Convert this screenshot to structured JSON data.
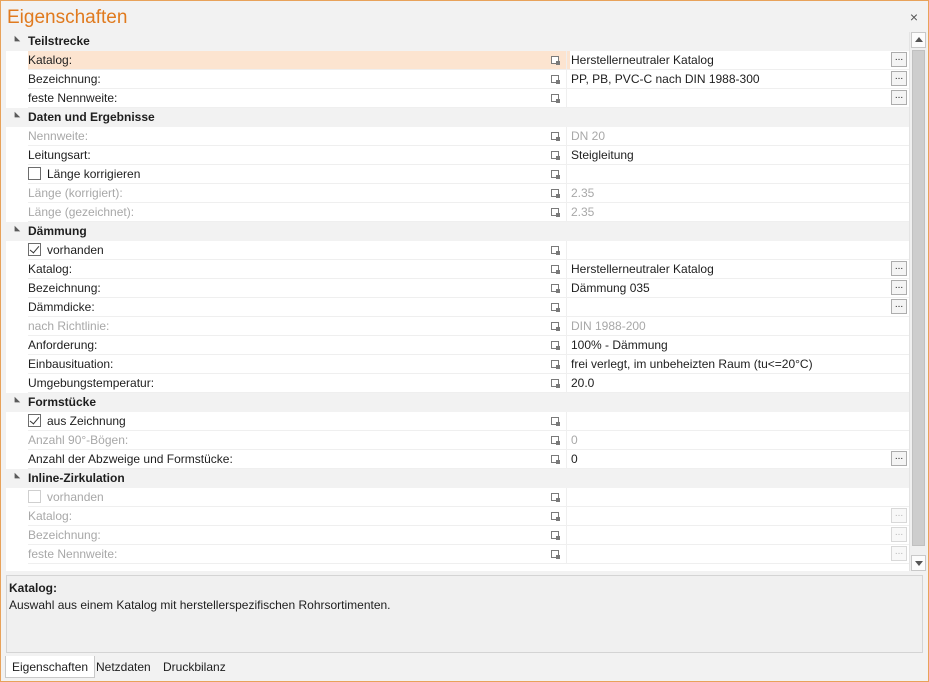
{
  "window": {
    "title": "Eigenschaften",
    "close_symbol": "×"
  },
  "groups": [
    {
      "title": "Teilstrecke",
      "rows": [
        {
          "type": "prop",
          "label": "Katalog:",
          "value": "Herstellerneutraler Katalog",
          "has_button": true,
          "disabled": false,
          "selected": true
        },
        {
          "type": "prop",
          "label": "Bezeichnung:",
          "value": "PP, PB, PVC-C nach DIN 1988-300",
          "has_button": true,
          "disabled": false
        },
        {
          "type": "prop",
          "label": "feste Nennweite:",
          "value": "",
          "has_button": true,
          "disabled": false
        }
      ]
    },
    {
      "title": "Daten und Ergebnisse",
      "rows": [
        {
          "type": "prop",
          "label": "Nennweite:",
          "value": "DN 20",
          "has_button": false,
          "disabled": true
        },
        {
          "type": "prop",
          "label": "Leitungsart:",
          "value": "Steigleitung",
          "has_button": false,
          "disabled": false
        },
        {
          "type": "check",
          "label": "Länge korrigieren",
          "checked": false,
          "disabled": false
        },
        {
          "type": "prop",
          "label": "Länge (korrigiert):",
          "value": "2.35",
          "has_button": false,
          "disabled": true
        },
        {
          "type": "prop",
          "label": "Länge (gezeichnet):",
          "value": "2.35",
          "has_button": false,
          "disabled": true
        }
      ]
    },
    {
      "title": "Dämmung",
      "rows": [
        {
          "type": "check",
          "label": "vorhanden",
          "checked": true,
          "disabled": false
        },
        {
          "type": "prop",
          "label": "Katalog:",
          "value": "Herstellerneutraler Katalog",
          "has_button": true,
          "disabled": false
        },
        {
          "type": "prop",
          "label": "Bezeichnung:",
          "value": "Dämmung 035",
          "has_button": true,
          "disabled": false
        },
        {
          "type": "prop",
          "label": "Dämmdicke:",
          "value": "",
          "has_button": true,
          "disabled": false
        },
        {
          "type": "prop",
          "label": "nach Richtlinie:",
          "value": "DIN 1988-200",
          "has_button": false,
          "disabled": true
        },
        {
          "type": "prop",
          "label": "Anforderung:",
          "value": "100% - Dämmung",
          "has_button": false,
          "disabled": false
        },
        {
          "type": "prop",
          "label": "Einbausituation:",
          "value": "frei verlegt, im unbeheizten Raum (tu<=20°C)",
          "has_button": false,
          "disabled": false
        },
        {
          "type": "prop",
          "label": "Umgebungstemperatur:",
          "value": "20.0",
          "has_button": false,
          "disabled": false
        }
      ]
    },
    {
      "title": "Formstücke",
      "rows": [
        {
          "type": "check",
          "label": "aus Zeichnung",
          "checked": true,
          "disabled": false
        },
        {
          "type": "prop",
          "label": "Anzahl 90°-Bögen:",
          "value": "0",
          "has_button": false,
          "disabled": true
        },
        {
          "type": "prop",
          "label": "Anzahl der Abzweige und Formstücke:",
          "value": "0",
          "has_button": true,
          "disabled": false
        }
      ]
    },
    {
      "title": "Inline-Zirkulation",
      "rows": [
        {
          "type": "check",
          "label": "vorhanden",
          "checked": false,
          "disabled": true
        },
        {
          "type": "prop",
          "label": "Katalog:",
          "value": "",
          "has_button": true,
          "disabled": true
        },
        {
          "type": "prop",
          "label": "Bezeichnung:",
          "value": "",
          "has_button": true,
          "disabled": true
        },
        {
          "type": "prop",
          "label": "feste Nennweite:",
          "value": "",
          "has_button": true,
          "disabled": true
        }
      ]
    }
  ],
  "button_label": "...",
  "description": {
    "title": "Katalog:",
    "text": "Auswahl aus einem Katalog mit herstellerspezifischen Rohrsortimenten."
  },
  "tabs": [
    {
      "label": "Eigenschaften",
      "active": true
    },
    {
      "label": "Netzdaten",
      "active": false
    },
    {
      "label": "Druckbilanz",
      "active": false
    }
  ],
  "colors": {
    "accent": "#e07a1e",
    "border_accent": "#e8a25a",
    "selection": "#fce4d0",
    "disabled_text": "#a8a8a8"
  }
}
